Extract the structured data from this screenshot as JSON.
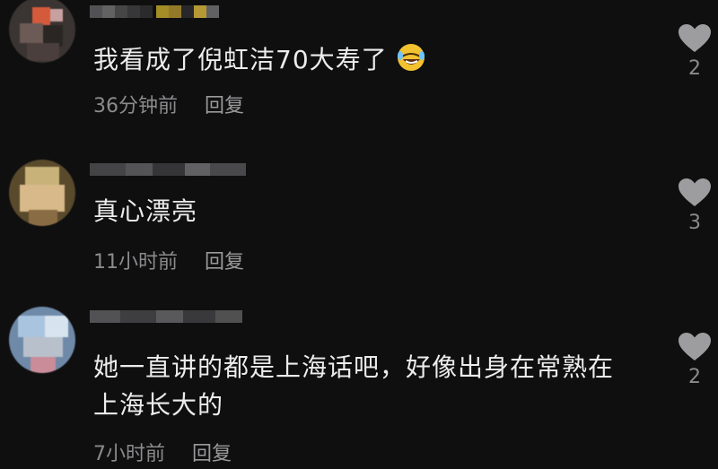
{
  "comments": [
    {
      "text": "我看成了倪虹洁70大寿了",
      "emoji": "rolling-on-floor-laughing-emoji",
      "time": "36分钟前",
      "reply_label": "回复",
      "likes": "2"
    },
    {
      "text": "真心漂亮",
      "time": "11小时前",
      "reply_label": "回复",
      "likes": "3"
    },
    {
      "text_lines": [
        "她一直讲的都是上海话吧，好像出身在常熟在",
        "上海长大的"
      ],
      "time": "7小时前",
      "reply_label": "回复",
      "likes": "2"
    }
  ],
  "colors": {
    "background": "#0f0f10",
    "text": "#ececec",
    "meta": "#8b8b8d",
    "heart": "#9d9d9f"
  },
  "icons": [
    "heart-icon"
  ]
}
